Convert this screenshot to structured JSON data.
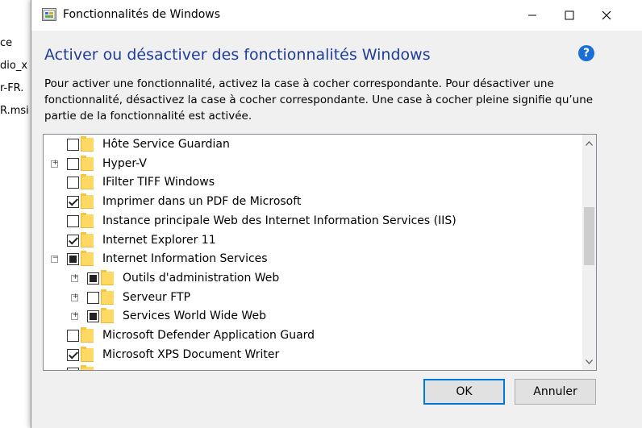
{
  "background": {
    "items": [
      "ce",
      "dio_x",
      "r-FR.",
      "R.msi"
    ]
  },
  "window": {
    "title": "Fonctionnalités de Windows",
    "minimize_glyph": "—",
    "maximize_glyph": "☐",
    "close_glyph": "✕"
  },
  "header": {
    "title": "Activer ou désactiver des fonctionnalités Windows",
    "help_glyph": "?"
  },
  "description": "Pour activer une fonctionnalité, activez la case à cocher correspondante. Pour désactiver une fonctionnalité, désactivez la case à cocher correspondante. Une case à cocher pleine signifie qu’une partie de la fonctionnalité est activée.",
  "features": [
    {
      "label": "Hôte Service Guardian",
      "level": 0,
      "state": "unchecked",
      "expander": ""
    },
    {
      "label": "Hyper-V",
      "level": 0,
      "state": "unchecked",
      "expander": "+"
    },
    {
      "label": "IFilter TIFF Windows",
      "level": 0,
      "state": "unchecked",
      "expander": ""
    },
    {
      "label": "Imprimer dans un PDF de Microsoft",
      "level": 0,
      "state": "checked",
      "expander": ""
    },
    {
      "label": "Instance principale Web des Internet Information Services (IIS)",
      "level": 0,
      "state": "unchecked",
      "expander": ""
    },
    {
      "label": "Internet Explorer 11",
      "level": 0,
      "state": "checked",
      "expander": ""
    },
    {
      "label": "Internet Information Services",
      "level": 0,
      "state": "partial",
      "expander": "−"
    },
    {
      "label": "Outils d'administration Web",
      "level": 1,
      "state": "partial",
      "expander": "+"
    },
    {
      "label": "Serveur FTP",
      "level": 1,
      "state": "unchecked",
      "expander": "+"
    },
    {
      "label": "Services World Wide Web",
      "level": 1,
      "state": "partial",
      "expander": "+"
    },
    {
      "label": "Microsoft Defender Application Guard",
      "level": 0,
      "state": "unchecked",
      "expander": ""
    },
    {
      "label": "Microsoft XPS Document Writer",
      "level": 0,
      "state": "checked",
      "expander": ""
    }
  ],
  "buttons": {
    "ok": "OK",
    "cancel": "Annuler"
  },
  "colors": {
    "heading": "#1f3d99",
    "accent": "#0078d7",
    "folder": "#ffd964"
  }
}
